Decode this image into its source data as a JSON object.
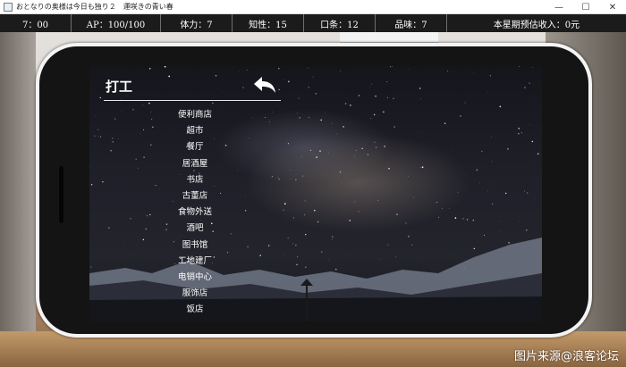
{
  "window": {
    "title": "おとなりの奥様は今日も独り２　運咲きの青い春",
    "minimize_glyph": "—",
    "maximize_glyph": "☐",
    "close_glyph": "✕"
  },
  "status": {
    "time": "7：00",
    "ap": "AP：100/100",
    "stamina": "体力：7",
    "intelligence": "知性：15",
    "eloquence": "口条：12",
    "taste": "品味：7",
    "weekly_income": "本星期预估收入：0元"
  },
  "screen": {
    "title": "打工",
    "back_icon": "back-arrow-icon",
    "jobs": [
      {
        "label": "便利商店"
      },
      {
        "label": "超市"
      },
      {
        "label": "餐厅"
      },
      {
        "label": "居酒屋"
      },
      {
        "label": "书店"
      },
      {
        "label": "古董店"
      },
      {
        "label": "食物外送"
      },
      {
        "label": "酒吧"
      },
      {
        "label": "图书馆"
      },
      {
        "label": "工地建厂"
      },
      {
        "label": "电销中心"
      },
      {
        "label": "服饰店"
      },
      {
        "label": "饭店"
      }
    ]
  },
  "watermark": "图片来源@浪客论坛"
}
